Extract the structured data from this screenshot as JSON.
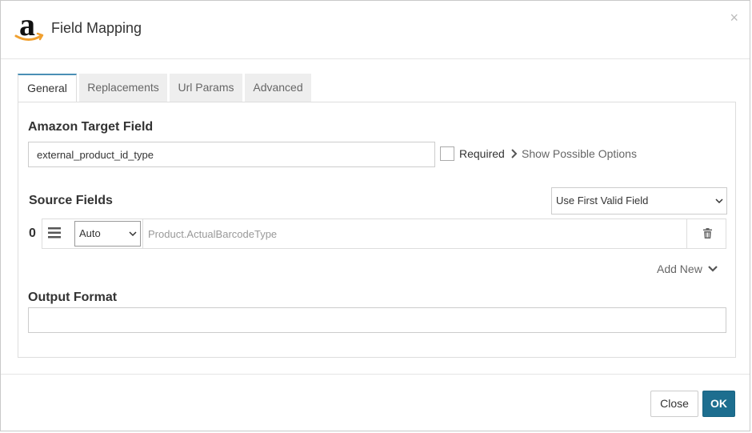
{
  "dialog": {
    "title": "Field Mapping",
    "logo_letter": "a",
    "close_symbol": "×"
  },
  "tabs": [
    {
      "label": "General",
      "active": true
    },
    {
      "label": "Replacements",
      "active": false
    },
    {
      "label": "Url Params",
      "active": false
    },
    {
      "label": "Advanced",
      "active": false
    }
  ],
  "target_field": {
    "label": "Amazon Target Field",
    "value": "external_product_id_type",
    "required_label": "Required",
    "required_checked": false,
    "show_options_label": "Show Possible Options"
  },
  "source_fields": {
    "label": "Source Fields",
    "strategy": "Use First Valid Field",
    "rows": [
      {
        "index": "0",
        "mode": "Auto",
        "value": "Product.ActualBarcodeType"
      }
    ],
    "add_new_label": "Add New"
  },
  "output_format": {
    "label": "Output Format",
    "value": ""
  },
  "footer": {
    "close_label": "Close",
    "ok_label": "OK"
  },
  "colors": {
    "accent": "#1d6e8f",
    "tab_active_border": "#4a8fb5",
    "logo_smile": "#f0a030"
  },
  "icons": {
    "logo": "amazon-logo",
    "drag": "drag-handle-icon",
    "trash": "trash-icon",
    "chevron_right": "chevron-right-icon",
    "chevron_down": "chevron-down-icon"
  }
}
